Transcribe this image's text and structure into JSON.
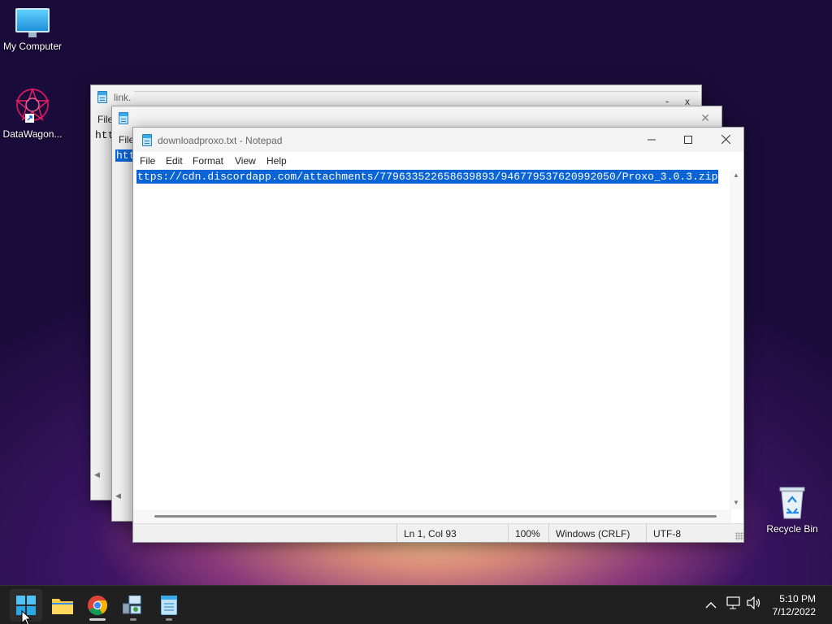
{
  "desktop": {
    "icons": [
      {
        "label": "My Computer"
      },
      {
        "label": "DataWagon..."
      },
      {
        "label": "Recycle Bin"
      }
    ]
  },
  "back_window_1": {
    "title": "link.",
    "menu": [
      "File"
    ],
    "text": "htt",
    "controls": {
      "minimize": "-",
      "close": "x"
    }
  },
  "back_window_2": {
    "menu": [
      "File"
    ],
    "text": "htt",
    "close": "✕"
  },
  "notepad": {
    "title": "downloadproxo.txt - Notepad",
    "menu": [
      "File",
      "Edit",
      "Format",
      "View",
      "Help"
    ],
    "content": "ttps://cdn.discordapp.com/attachments/779633522658639893/946779537620992050/Proxo_3.0.3.zip",
    "status": {
      "position": "Ln 1, Col 93",
      "zoom": "100%",
      "line_ending": "Windows (CRLF)",
      "encoding": "UTF-8"
    }
  },
  "taskbar": {
    "apps": [
      {
        "icon": "windows-start-icon"
      },
      {
        "icon": "file-explorer-icon"
      },
      {
        "icon": "chrome-icon"
      },
      {
        "icon": "network-tool-icon"
      },
      {
        "icon": "notepad-icon"
      }
    ],
    "clock": {
      "time": "5:10 PM",
      "date": "7/12/2022"
    }
  },
  "colors": {
    "selection": "#0a64d6",
    "taskbar": "#202020",
    "accent": "#0078d4"
  }
}
